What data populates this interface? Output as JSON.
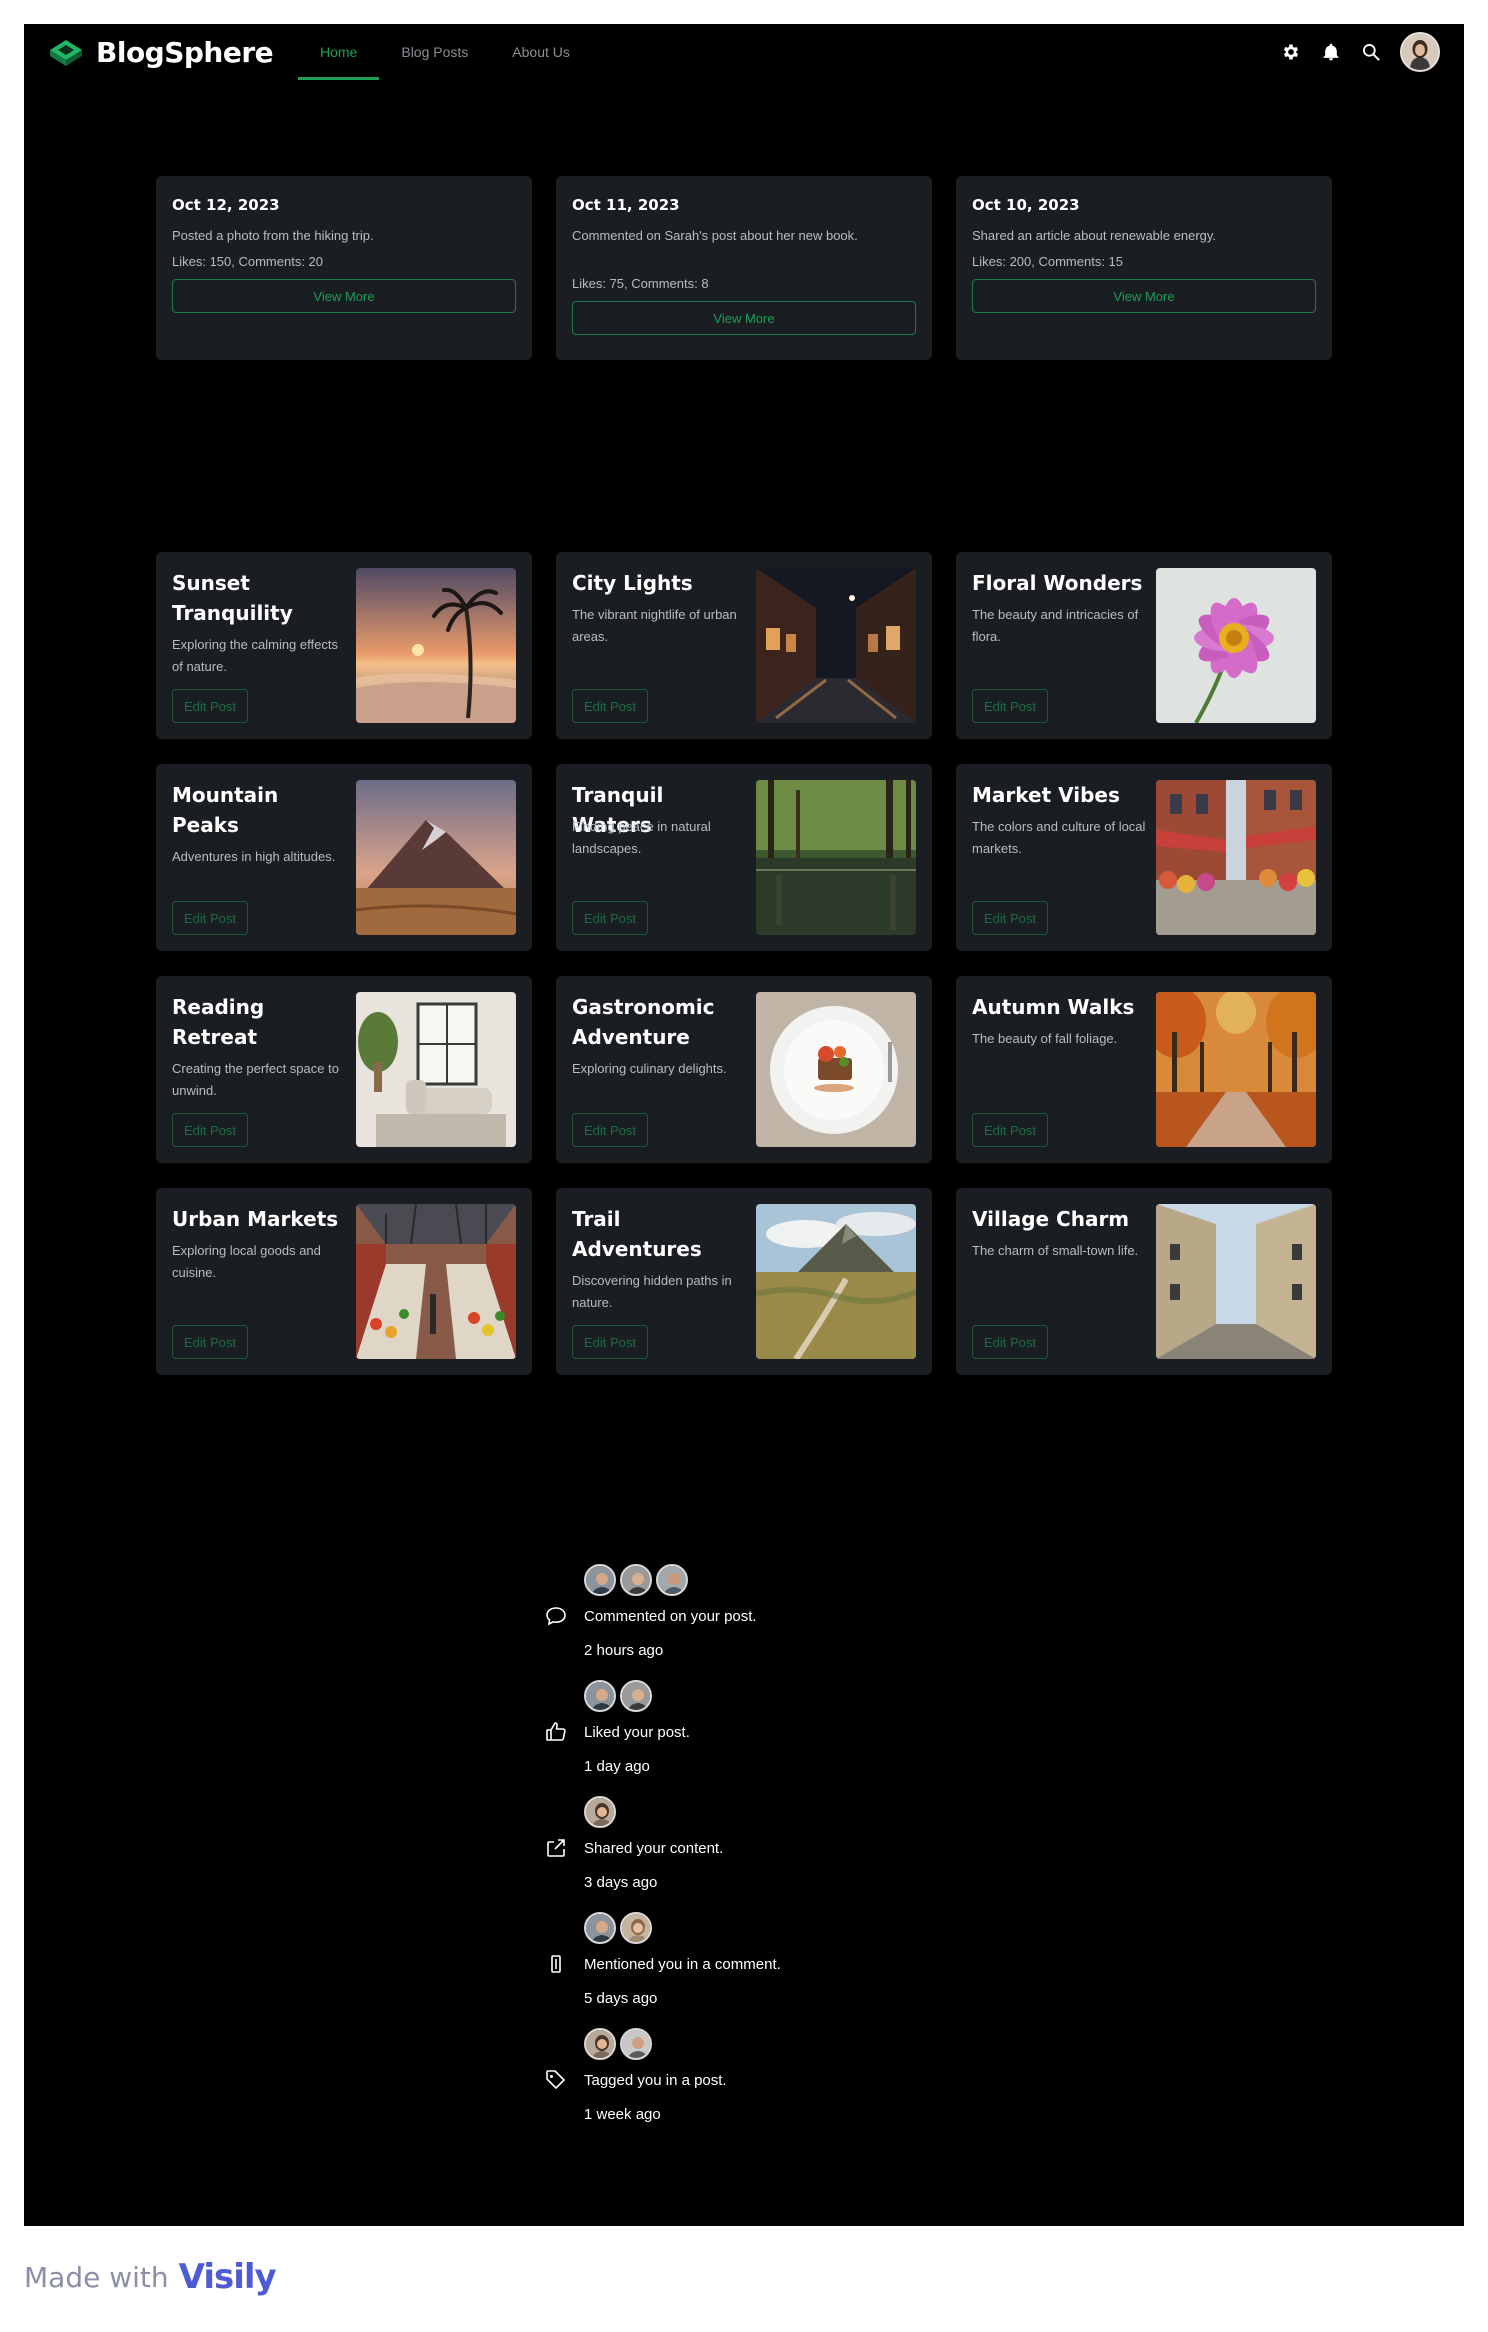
{
  "app": {
    "name": "BlogSphere",
    "accent": "#1f9d57"
  },
  "nav": {
    "items": [
      {
        "label": "Home",
        "active": true
      },
      {
        "label": "Blog Posts",
        "active": false
      },
      {
        "label": "About Us",
        "active": false
      }
    ]
  },
  "header_icons": [
    "gear-icon",
    "bell-icon",
    "search-icon",
    "user-avatar"
  ],
  "activities": [
    {
      "date": "Oct 12, 2023",
      "description": "Posted a photo from the hiking trip.",
      "stats": "Likes: 150, Comments: 20",
      "button": "View More"
    },
    {
      "date": "Oct 11, 2023",
      "description": "Commented on Sarah's post about her new book.",
      "stats": "Likes: 75, Comments: 8",
      "button": "View More"
    },
    {
      "date": "Oct 10, 2023",
      "description": "Shared an article about renewable energy.",
      "stats": "Likes: 200, Comments: 15",
      "button": "View More"
    }
  ],
  "posts": [
    {
      "title": "Sunset Tranquility",
      "description": "Exploring the calming effects of nature.",
      "button": "Edit Post",
      "image": "sunset-beach"
    },
    {
      "title": "City Lights",
      "description": "The vibrant nightlife of urban areas.",
      "button": "Edit Post",
      "image": "night-street"
    },
    {
      "title": "Floral Wonders",
      "description": "The beauty and intricacies of flora.",
      "button": "Edit Post",
      "image": "pink-flower"
    },
    {
      "title": "Mountain Peaks",
      "description": "Adventures in high altitudes.",
      "button": "Edit Post",
      "image": "mountain"
    },
    {
      "title": "Tranquil Waters",
      "description": "Finding peace in natural landscapes.",
      "button": "Edit Post",
      "image": "forest-lake"
    },
    {
      "title": "Market Vibes",
      "description": "The colors and culture of local markets.",
      "button": "Edit Post",
      "image": "market-street"
    },
    {
      "title": "Reading Retreat",
      "description": "Creating the perfect space to unwind.",
      "button": "Edit Post",
      "image": "reading-room"
    },
    {
      "title": "Gastronomic Adventure",
      "description": "Exploring culinary delights.",
      "button": "Edit Post",
      "image": "plated-dish"
    },
    {
      "title": "Autumn Walks",
      "description": "The beauty of fall foliage.",
      "button": "Edit Post",
      "image": "autumn-path"
    },
    {
      "title": "Urban Markets",
      "description": "Exploring local goods and cuisine.",
      "button": "Edit Post",
      "image": "market-hall"
    },
    {
      "title": "Trail Adventures",
      "description": "Discovering hidden paths in nature.",
      "button": "Edit Post",
      "image": "mountain-trail"
    },
    {
      "title": "Village Charm",
      "description": "The charm of small-town life.",
      "button": "Edit Post",
      "image": "village-street"
    }
  ],
  "notifications": [
    {
      "icon": "comment-icon",
      "avatars": 3,
      "text": "Commented on your post.",
      "time": "2 hours ago"
    },
    {
      "icon": "thumbs-up-icon",
      "avatars": 2,
      "text": "Liked your post.",
      "time": "1 day ago"
    },
    {
      "icon": "share-icon",
      "avatars": 1,
      "text": "Shared your content.",
      "time": "3 days ago"
    },
    {
      "icon": "mention-icon",
      "avatars": 2,
      "text": "Mentioned you in a comment.",
      "time": "5 days ago"
    },
    {
      "icon": "tag-icon",
      "avatars": 2,
      "text": "Tagged you in a post.",
      "time": "1 week ago"
    }
  ],
  "footer": {
    "made_with": "Made with",
    "brand": "Visily"
  }
}
